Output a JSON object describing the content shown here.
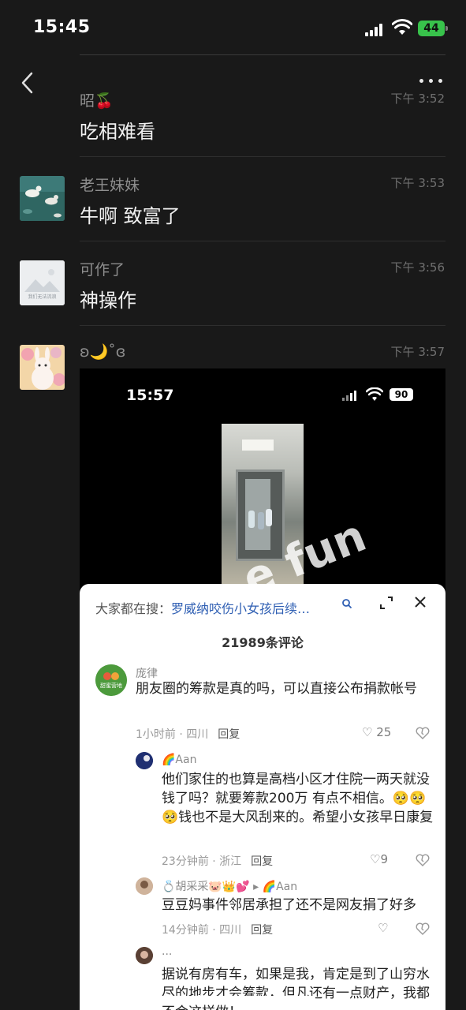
{
  "status_bar": {
    "time": "15:45",
    "battery": "44"
  },
  "messages": [
    {
      "name": "昭🍒",
      "time": "下午 3:52",
      "text": "吃相难看"
    },
    {
      "name": "老王妹妹",
      "time": "下午 3:53",
      "text": "牛啊 致富了"
    },
    {
      "name": "可作了",
      "time": "下午 3:56",
      "text": "神操作"
    },
    {
      "name": "ʚ🌙˚ɞ",
      "time": "下午 3:57"
    }
  ],
  "avatar_caption": "我们无法流浪",
  "screenshot": {
    "status_time": "15:57",
    "battery": "90",
    "watermark": "e fun",
    "search_prefix": "大家都在搜：",
    "search_query": "罗威纳咬伤小女孩后续…",
    "comment_count": "21989条评论",
    "comments": [
      {
        "name": "庞律",
        "text": "朋友圈的筹款是真的吗，可以直接公布捐款帐号",
        "meta": "1小时前 · 四川",
        "reply": "回复",
        "likes": "25"
      },
      {
        "name": "🌈Aan",
        "text": "他们家住的也算是高档小区才住院一两天就没钱了吗？就要筹款200万 有点不相信。🥺🥺🥺钱也不是大风刮来的。希望小女孩早日康复",
        "meta": "23分钟前 · 浙江",
        "reply": "回复",
        "likes": "9"
      },
      {
        "name": "💍胡采采🐷👑💕 ▸ 🌈Aan",
        "text": "豆豆妈事件邻居承担了还不是网友捐了好多",
        "meta": "14分钟前 · 四川",
        "reply": "回复",
        "likes": ""
      },
      {
        "name": "...",
        "text": "据说有房有车，如果是我，肯定是到了山穷水尽的地步才会筹款，但凡还有一点财产，我都不会这样做！"
      }
    ],
    "avatar_brand": "甜蜜营地"
  }
}
